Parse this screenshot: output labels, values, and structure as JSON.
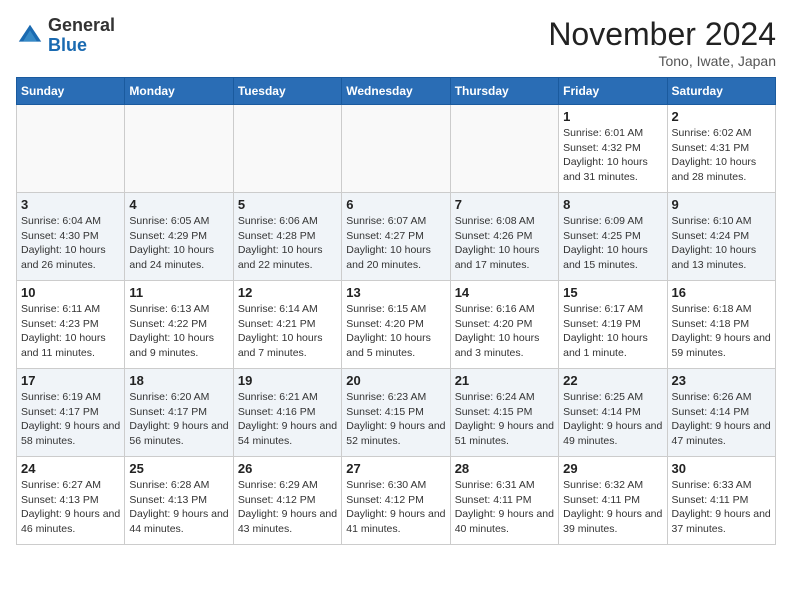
{
  "header": {
    "logo_general": "General",
    "logo_blue": "Blue",
    "month_title": "November 2024",
    "location": "Tono, Iwate, Japan"
  },
  "days_of_week": [
    "Sunday",
    "Monday",
    "Tuesday",
    "Wednesday",
    "Thursday",
    "Friday",
    "Saturday"
  ],
  "weeks": [
    [
      {
        "day": "",
        "info": ""
      },
      {
        "day": "",
        "info": ""
      },
      {
        "day": "",
        "info": ""
      },
      {
        "day": "",
        "info": ""
      },
      {
        "day": "",
        "info": ""
      },
      {
        "day": "1",
        "info": "Sunrise: 6:01 AM\nSunset: 4:32 PM\nDaylight: 10 hours and 31 minutes."
      },
      {
        "day": "2",
        "info": "Sunrise: 6:02 AM\nSunset: 4:31 PM\nDaylight: 10 hours and 28 minutes."
      }
    ],
    [
      {
        "day": "3",
        "info": "Sunrise: 6:04 AM\nSunset: 4:30 PM\nDaylight: 10 hours and 26 minutes."
      },
      {
        "day": "4",
        "info": "Sunrise: 6:05 AM\nSunset: 4:29 PM\nDaylight: 10 hours and 24 minutes."
      },
      {
        "day": "5",
        "info": "Sunrise: 6:06 AM\nSunset: 4:28 PM\nDaylight: 10 hours and 22 minutes."
      },
      {
        "day": "6",
        "info": "Sunrise: 6:07 AM\nSunset: 4:27 PM\nDaylight: 10 hours and 20 minutes."
      },
      {
        "day": "7",
        "info": "Sunrise: 6:08 AM\nSunset: 4:26 PM\nDaylight: 10 hours and 17 minutes."
      },
      {
        "day": "8",
        "info": "Sunrise: 6:09 AM\nSunset: 4:25 PM\nDaylight: 10 hours and 15 minutes."
      },
      {
        "day": "9",
        "info": "Sunrise: 6:10 AM\nSunset: 4:24 PM\nDaylight: 10 hours and 13 minutes."
      }
    ],
    [
      {
        "day": "10",
        "info": "Sunrise: 6:11 AM\nSunset: 4:23 PM\nDaylight: 10 hours and 11 minutes."
      },
      {
        "day": "11",
        "info": "Sunrise: 6:13 AM\nSunset: 4:22 PM\nDaylight: 10 hours and 9 minutes."
      },
      {
        "day": "12",
        "info": "Sunrise: 6:14 AM\nSunset: 4:21 PM\nDaylight: 10 hours and 7 minutes."
      },
      {
        "day": "13",
        "info": "Sunrise: 6:15 AM\nSunset: 4:20 PM\nDaylight: 10 hours and 5 minutes."
      },
      {
        "day": "14",
        "info": "Sunrise: 6:16 AM\nSunset: 4:20 PM\nDaylight: 10 hours and 3 minutes."
      },
      {
        "day": "15",
        "info": "Sunrise: 6:17 AM\nSunset: 4:19 PM\nDaylight: 10 hours and 1 minute."
      },
      {
        "day": "16",
        "info": "Sunrise: 6:18 AM\nSunset: 4:18 PM\nDaylight: 9 hours and 59 minutes."
      }
    ],
    [
      {
        "day": "17",
        "info": "Sunrise: 6:19 AM\nSunset: 4:17 PM\nDaylight: 9 hours and 58 minutes."
      },
      {
        "day": "18",
        "info": "Sunrise: 6:20 AM\nSunset: 4:17 PM\nDaylight: 9 hours and 56 minutes."
      },
      {
        "day": "19",
        "info": "Sunrise: 6:21 AM\nSunset: 4:16 PM\nDaylight: 9 hours and 54 minutes."
      },
      {
        "day": "20",
        "info": "Sunrise: 6:23 AM\nSunset: 4:15 PM\nDaylight: 9 hours and 52 minutes."
      },
      {
        "day": "21",
        "info": "Sunrise: 6:24 AM\nSunset: 4:15 PM\nDaylight: 9 hours and 51 minutes."
      },
      {
        "day": "22",
        "info": "Sunrise: 6:25 AM\nSunset: 4:14 PM\nDaylight: 9 hours and 49 minutes."
      },
      {
        "day": "23",
        "info": "Sunrise: 6:26 AM\nSunset: 4:14 PM\nDaylight: 9 hours and 47 minutes."
      }
    ],
    [
      {
        "day": "24",
        "info": "Sunrise: 6:27 AM\nSunset: 4:13 PM\nDaylight: 9 hours and 46 minutes."
      },
      {
        "day": "25",
        "info": "Sunrise: 6:28 AM\nSunset: 4:13 PM\nDaylight: 9 hours and 44 minutes."
      },
      {
        "day": "26",
        "info": "Sunrise: 6:29 AM\nSunset: 4:12 PM\nDaylight: 9 hours and 43 minutes."
      },
      {
        "day": "27",
        "info": "Sunrise: 6:30 AM\nSunset: 4:12 PM\nDaylight: 9 hours and 41 minutes."
      },
      {
        "day": "28",
        "info": "Sunrise: 6:31 AM\nSunset: 4:11 PM\nDaylight: 9 hours and 40 minutes."
      },
      {
        "day": "29",
        "info": "Sunrise: 6:32 AM\nSunset: 4:11 PM\nDaylight: 9 hours and 39 minutes."
      },
      {
        "day": "30",
        "info": "Sunrise: 6:33 AM\nSunset: 4:11 PM\nDaylight: 9 hours and 37 minutes."
      }
    ]
  ]
}
